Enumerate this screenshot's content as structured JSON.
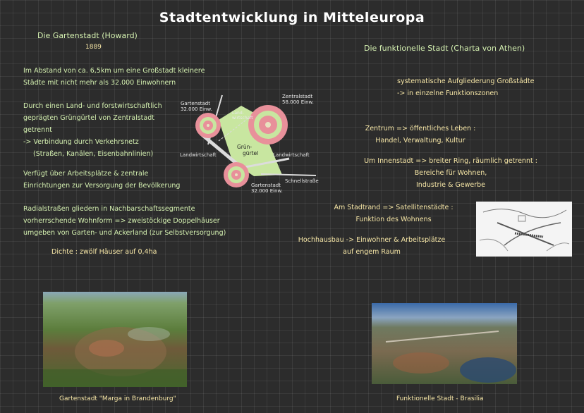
{
  "title": "Stadtentwicklung in Mitteleuropa",
  "left": {
    "heading": "Die Gartenstadt (Howard)",
    "year": "1889",
    "para1": [
      "Im Abstand von ca. 6,5km um eine Großstadt kleinere",
      "Städte mit nicht mehr als 32.000 Einwohnern"
    ],
    "para2": [
      "Durch einen Land- und forstwirtschaftlich",
      "geprägten Grüngürtel von Zentralstadt",
      "getrennt",
      "-> Verbindung durch Verkehrsnetz",
      "(Straßen, Kanälen, Eisenbahnlinien)"
    ],
    "para3": [
      "Verfügt über Arbeitsplätze & zentrale",
      "Einrichtungen zur Versorgung der Bevölkerung"
    ],
    "para4": [
      "Radialstraßen gliedern in Nachbarschaftssegmente",
      "vorherrschende Wohnform => zweistöckige Doppelhäuser",
      "umgeben von Garten- und Ackerland (zur Selbstversorgung)"
    ],
    "density": "Dichte : zwölf Häuser auf 0,4ha",
    "photo_caption": "Gartenstadt \"Marga in Brandenburg\""
  },
  "diagram": {
    "garden_city_a": [
      "Gartenstadt",
      "32.000 Einw."
    ],
    "central_city": [
      "Zentralstadt",
      "58.000 Einw."
    ],
    "garden_city_b": [
      "Gartenstadt",
      "32.000 Einw."
    ],
    "agri_label": [
      "Land-",
      "wirtschaft"
    ],
    "greenbelt": [
      "Grün-",
      "gürtel"
    ],
    "landwirtschaft_left": "Landwirtschaft",
    "landwirtschaft_right": "Landwirtschaft",
    "express_road": "Schnellstraße"
  },
  "right": {
    "heading": "Die funktionelle Stadt (Charta von Athen)",
    "para1": [
      "systematische Aufgliederung Großstädte",
      "-> in einzelne Funktionszonen"
    ],
    "para2": [
      "Zentrum => öffentliches Leben :",
      "Handel, Verwaltung, Kultur"
    ],
    "para3": [
      "Um Innenstadt => breiter Ring, räumlich getrennt :",
      "Bereiche für Wohnen,",
      "Industrie & Gewerbe"
    ],
    "para4": [
      "Am Stadtrand => Satellitenstädte :",
      "Funktion des Wohnens"
    ],
    "para5": [
      "Hochhausbau -> Einwohner & Arbeitsplätze",
      "auf engem Raum"
    ],
    "photo_caption": "Funktionelle Stadt - Brasilia"
  },
  "colors": {
    "background": "#2c2c2c",
    "green_text": "#d4f0b0",
    "yellow_text": "#f6e6a6",
    "greenbelt": "#c8e6a0",
    "city_ring": "#e8909a"
  }
}
